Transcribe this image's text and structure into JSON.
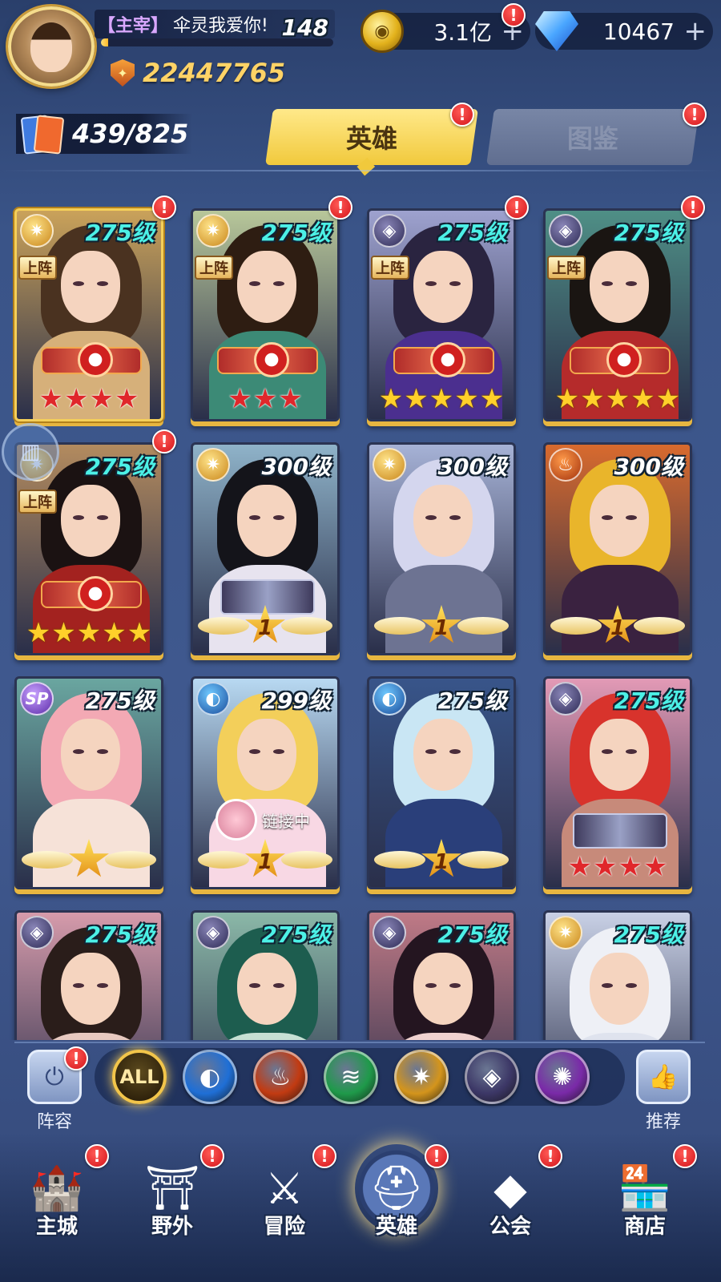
{
  "player": {
    "level": "148",
    "title": "【主宰】",
    "name": "伞灵我爱你!",
    "exp_progress": 0.03,
    "power": "22447765"
  },
  "resources": {
    "coins": "3.1亿",
    "gems": "10467",
    "plus": "+"
  },
  "heroes_owned": "439/825",
  "tabs": [
    {
      "label": "英雄",
      "active": true
    },
    {
      "label": "图鉴",
      "active": false
    }
  ],
  "badge_mark": "!",
  "deploy_label": "上阵",
  "link_label": "链接中",
  "hero_cards": [
    {
      "level": "275级",
      "element": "light",
      "deployed": true,
      "stars": 4,
      "star_color": "red",
      "emblem": "seal",
      "lvl_color": "cyan",
      "badge": true,
      "gold_frame": true,
      "hair": "#4a3220",
      "body": "#d6b07a",
      "bg": "#caa25a"
    },
    {
      "level": "275级",
      "element": "light",
      "deployed": true,
      "stars": 3,
      "star_color": "red",
      "emblem": "seal",
      "lvl_color": "cyan",
      "badge": true,
      "hair": "#2e1d12",
      "body": "#3c8a76",
      "bg": "#b8c79a"
    },
    {
      "level": "275级",
      "element": "dark",
      "deployed": true,
      "stars": 5,
      "star_color": "gold",
      "emblem": "seal",
      "lvl_color": "cyan",
      "badge": true,
      "hair": "#2a2440",
      "body": "#4b2f8f",
      "bg": "#9ea2cf"
    },
    {
      "level": "275级",
      "element": "dark",
      "deployed": true,
      "stars": 5,
      "star_color": "gold",
      "emblem": "seal",
      "lvl_color": "cyan",
      "badge": true,
      "hair": "#1a1512",
      "body": "#b52b2b",
      "bg": "#4f8f86"
    },
    {
      "level": "275级",
      "element": "light",
      "deployed": true,
      "stars": 5,
      "star_color": "gold",
      "emblem": "seal",
      "lvl_color": "cyan",
      "badge": true,
      "hair": "#1b1212",
      "body": "#a3221f",
      "bg": "#b38b5f"
    },
    {
      "level": "300级",
      "element": "light",
      "deployed": false,
      "awaken": "1",
      "emblem": "crest",
      "lvl_color": "white",
      "badge": false,
      "hair": "#14141a",
      "body": "#e7e3ef",
      "bg": "#8fb3c9"
    },
    {
      "level": "300级",
      "element": "light",
      "deployed": false,
      "awaken": "1",
      "emblem": "none",
      "lvl_color": "white",
      "badge": false,
      "hair": "#d4d6ee",
      "body": "#6d7392",
      "bg": "#a6b2d6"
    },
    {
      "level": "300级",
      "element": "fire",
      "deployed": false,
      "awaken": "1",
      "emblem": "none",
      "lvl_color": "white",
      "badge": false,
      "hair": "#e9b52b",
      "body": "#3a2240",
      "bg": "#d86a2e"
    },
    {
      "level": "275级",
      "element": "sp",
      "element_label": "SP",
      "deployed": false,
      "awaken": "",
      "emblem": "none",
      "lvl_color": "white",
      "badge": false,
      "hair": "#f3a9b4",
      "body": "#f6e2d8",
      "bg": "#6aa6a0"
    },
    {
      "level": "299级",
      "element": "water",
      "deployed": false,
      "awaken": "1",
      "emblem": "link",
      "lvl_color": "white",
      "badge": false,
      "hair": "#f3cf5a",
      "body": "#f8d8e4",
      "bg": "#b8d9f2"
    },
    {
      "level": "275级",
      "element": "water",
      "deployed": false,
      "awaken": "1",
      "emblem": "none",
      "lvl_color": "white",
      "badge": false,
      "hair": "#c9e6f4",
      "body": "#2a3f7a",
      "bg": "#38558a"
    },
    {
      "level": "275级",
      "element": "dark",
      "deployed": false,
      "stars": 4,
      "star_color": "red",
      "emblem": "crest",
      "lvl_color": "cyan",
      "badge": false,
      "hair": "#d8332c",
      "body": "#c78a7a",
      "bg": "#e39ab6"
    },
    {
      "level": "275级",
      "element": "dark",
      "deployed": false,
      "emblem": "none",
      "lvl_color": "cyan",
      "badge": false,
      "hair": "#2a1d1a",
      "body": "#e7c9c0",
      "bg": "#d69bab"
    },
    {
      "level": "275级",
      "element": "dark",
      "deployed": false,
      "emblem": "none",
      "lvl_color": "cyan",
      "badge": false,
      "hair": "#1d5d4f",
      "body": "#c7e0d4",
      "bg": "#8bb8a8"
    },
    {
      "level": "275级",
      "element": "dark",
      "deployed": false,
      "emblem": "none",
      "lvl_color": "cyan",
      "badge": false,
      "hair": "#241520",
      "body": "#f0d2d0",
      "bg": "#c07a86"
    },
    {
      "level": "275级",
      "element": "light",
      "deployed": false,
      "emblem": "none",
      "lvl_color": "cyan",
      "badge": false,
      "hair": "#eef0f6",
      "body": "#dfe3ee",
      "bg": "#c9d1e6"
    }
  ],
  "filters": [
    {
      "label": "ALL",
      "element": "all",
      "active": true
    },
    {
      "element": "water",
      "color": "#1f6fd6"
    },
    {
      "element": "fire",
      "color": "#c23b12"
    },
    {
      "element": "wind",
      "color": "#1f9a4a"
    },
    {
      "element": "light",
      "color": "#d4951c"
    },
    {
      "element": "dark",
      "color": "#3c3766"
    },
    {
      "element": "chaos",
      "color": "#7a2aa8"
    }
  ],
  "side_buttons": {
    "lineup": "阵容",
    "recommend": "推荐"
  },
  "nav": [
    {
      "label": "主城",
      "icon": "castle-icon",
      "badge": true
    },
    {
      "label": "野外",
      "icon": "portal-icon",
      "badge": true
    },
    {
      "label": "冒险",
      "icon": "sword-icon",
      "badge": true
    },
    {
      "label": "英雄",
      "icon": "helmet-icon",
      "badge": true,
      "active": true
    },
    {
      "label": "公会",
      "icon": "banner-icon",
      "badge": true
    },
    {
      "label": "商店",
      "icon": "shop-icon",
      "badge": true
    }
  ]
}
